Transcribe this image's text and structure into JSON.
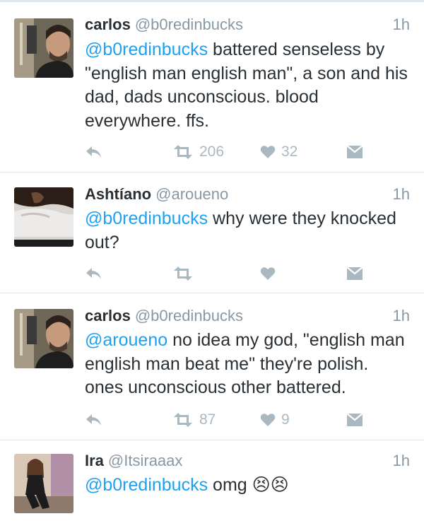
{
  "tweets": [
    {
      "name": "carlos",
      "handle": "@b0redinbucks",
      "time": "1h",
      "mention": "@b0redinbucks",
      "text": " battered senseless by \"english man english man\", a son and his dad, dads unconscious. blood everywhere. ffs.",
      "retweets": "206",
      "likes": "32",
      "avatar": "avatar-carlos"
    },
    {
      "name": "Ashtíano",
      "handle": "@aroueno",
      "time": "1h",
      "mention": "@b0redinbucks",
      "text": " why were they knocked out?",
      "retweets": "",
      "likes": "",
      "avatar": "avatar-ashtiano"
    },
    {
      "name": "carlos",
      "handle": "@b0redinbucks",
      "time": "1h",
      "mention": "@aroueno",
      "text": " no idea my god, \"english man english man beat me\" they're polish. ones unconscious other battered.",
      "retweets": "87",
      "likes": "9",
      "avatar": "avatar-carlos"
    },
    {
      "name": "Ira",
      "handle": "@Itsiraaax",
      "time": "1h",
      "mention": "@b0redinbucks",
      "text": " omg ",
      "emoji": "😣😣",
      "avatar": "avatar-ira"
    }
  ],
  "colors": {
    "link": "#1da1f2",
    "muted": "#8899a6",
    "icon": "#aab8c2",
    "divider": "#e1e8ed"
  }
}
